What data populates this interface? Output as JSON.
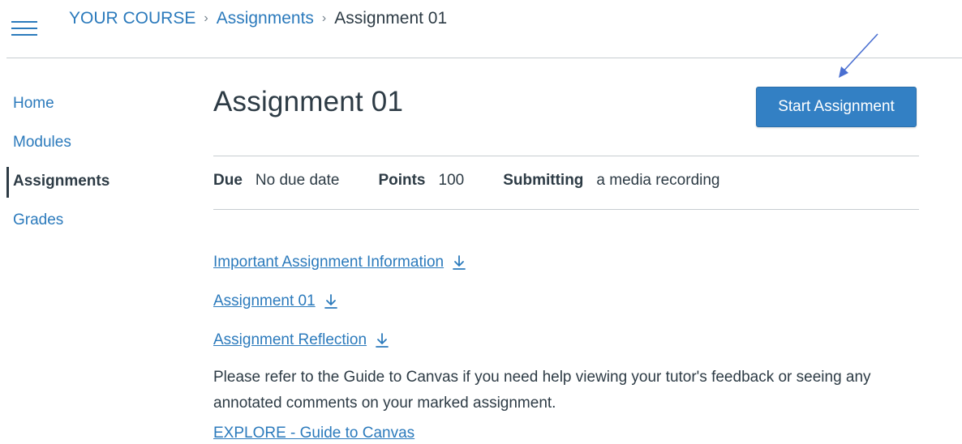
{
  "header": {
    "breadcrumb": {
      "course": "YOUR COURSE",
      "section": "Assignments",
      "current": "Assignment 01"
    }
  },
  "sidebar": {
    "items": [
      {
        "label": "Home",
        "active": false
      },
      {
        "label": "Modules",
        "active": false
      },
      {
        "label": "Assignments",
        "active": true
      },
      {
        "label": "Grades",
        "active": false
      }
    ]
  },
  "assignment": {
    "title": "Assignment 01",
    "start_button_label": "Start Assignment",
    "details": {
      "due_label": "Due",
      "due_value": "No due date",
      "points_label": "Points",
      "points_value": "100",
      "submitting_label": "Submitting",
      "submitting_value": "a media recording"
    },
    "files": [
      {
        "label": "Important Assignment Information",
        "icon": "download-icon"
      },
      {
        "label": "Assignment 01",
        "icon": "download-icon"
      },
      {
        "label": "Assignment Reflection",
        "icon": "download-icon"
      }
    ],
    "help_text": "Please refer to the Guide to Canvas if you need help viewing your tutor's feedback or seeing any annotated comments on your marked assignment.",
    "explore_link": "EXPLORE - Guide to Canvas"
  },
  "colors": {
    "link": "#2b7abc",
    "text": "#2d3b45",
    "button": "#3380c4",
    "divider": "#c7cdd1",
    "annotation_arrow": "#4a6fd1"
  }
}
